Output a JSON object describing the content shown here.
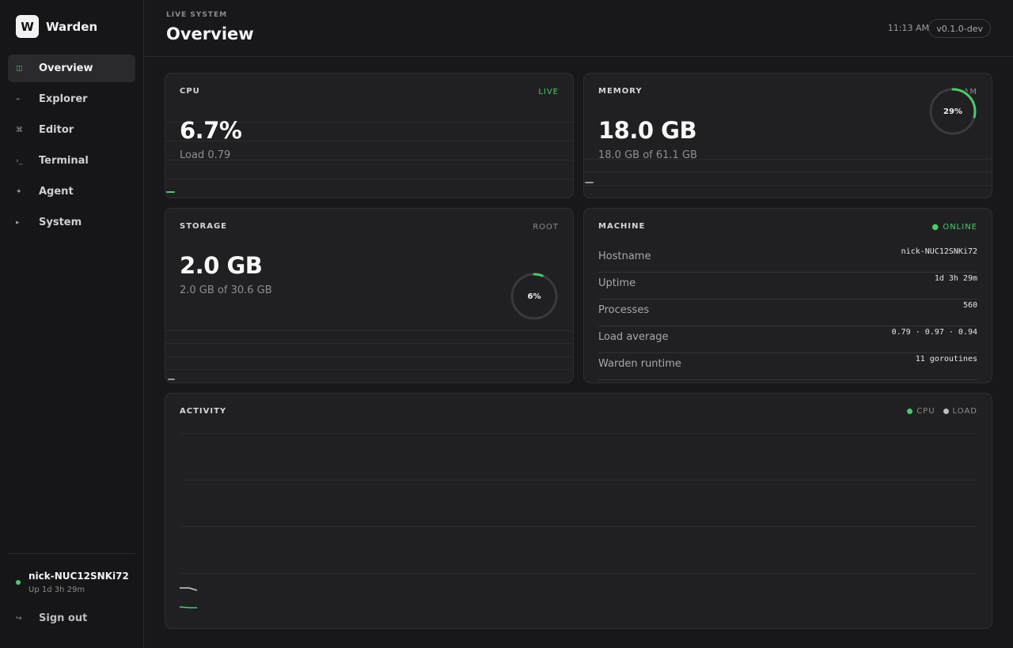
{
  "brand": {
    "logo_letter": "W",
    "name": "Warden"
  },
  "nav": {
    "items": [
      {
        "label": "Overview",
        "icon": "◫",
        "icon_name": "overview-icon"
      },
      {
        "label": "Explorer",
        "icon": "⌁",
        "icon_name": "explorer-icon"
      },
      {
        "label": "Editor",
        "icon": "⌘",
        "icon_name": "editor-icon"
      },
      {
        "label": "Terminal",
        "icon": "›_",
        "icon_name": "terminal-icon"
      },
      {
        "label": "Agent",
        "icon": "✦",
        "icon_name": "agent-icon"
      },
      {
        "label": "System",
        "icon": "▸",
        "icon_name": "system-icon"
      }
    ],
    "active": "Overview"
  },
  "user": {
    "host": "nick-NUC12SNKi72",
    "uptime": "Up 1d 3h 29m",
    "status_color": "#4cc96a"
  },
  "signout": {
    "label": "Sign out",
    "icon": "↪"
  },
  "header": {
    "eyebrow": "LIVE SYSTEM",
    "title": "Overview",
    "time": "11:13 AM",
    "version": "v0.1.0-dev"
  },
  "cpu": {
    "title": "CPU",
    "tag": "LIVE",
    "value": "6.7%",
    "sub": "Load 0.79",
    "percent": 6.7
  },
  "memory": {
    "title": "MEMORY",
    "tag": "RAM",
    "value": "18.0 GB",
    "sub": "18.0 GB of 61.1 GB",
    "ring_label": "29%",
    "percent": 29
  },
  "storage": {
    "title": "STORAGE",
    "tag": "ROOT",
    "value": "2.0 GB",
    "sub": "2.0 GB of 30.6 GB",
    "ring_label": "6%",
    "percent": 6
  },
  "machine": {
    "title": "MACHINE",
    "status": "● ONLINE",
    "rows": [
      {
        "key": "Hostname",
        "value": "nick-NUC12SNKi72"
      },
      {
        "key": "Uptime",
        "value": "1d 3h 29m"
      },
      {
        "key": "Processes",
        "value": "560"
      },
      {
        "key": "Load average",
        "value": "0.79 · 0.97 · 0.94"
      },
      {
        "key": "Warden runtime",
        "value": "11 goroutines"
      }
    ]
  },
  "activity": {
    "title": "ACTIVITY",
    "legend": [
      {
        "label": "CPU",
        "color": "#4cc96a"
      },
      {
        "label": "LOAD",
        "color": "#bdbdbd"
      }
    ]
  },
  "colors": {
    "accent": "#4cc96a",
    "track": "#3a3a3e"
  }
}
